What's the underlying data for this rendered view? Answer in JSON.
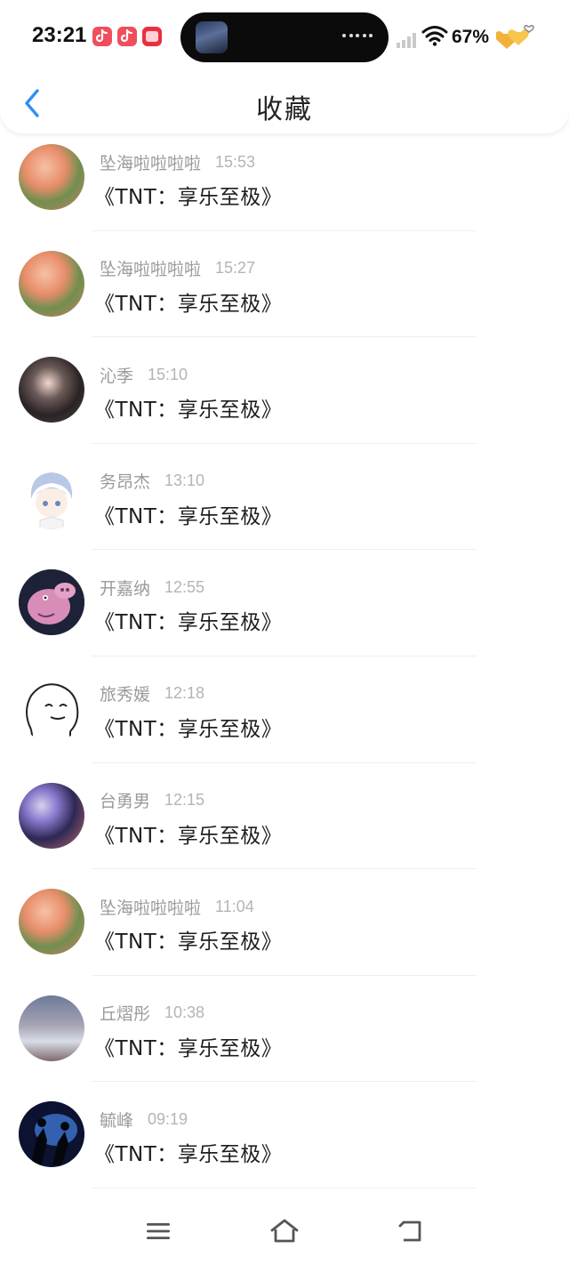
{
  "status_bar": {
    "time": "23:21",
    "battery": "67%",
    "notification_icons": [
      "douyin-icon",
      "douyin-icon",
      "app-icon"
    ]
  },
  "nav": {
    "title": "收藏",
    "back_icon": "chevron-left-icon",
    "accent_color": "#2f8ff5"
  },
  "messages": [
    {
      "name": "坠海啦啦啦啦",
      "time": "15:53",
      "text": "《TNT：享乐至极》"
    },
    {
      "name": "坠海啦啦啦啦",
      "time": "15:27",
      "text": "《TNT：享乐至极》"
    },
    {
      "name": "沁季",
      "time": "15:10",
      "text": "《TNT：享乐至极》"
    },
    {
      "name": "务昂杰",
      "time": "13:10",
      "text": "《TNT：享乐至极》"
    },
    {
      "name": "开嘉纳",
      "time": "12:55",
      "text": "《TNT：享乐至极》"
    },
    {
      "name": "旅秀媛",
      "time": "12:18",
      "text": "《TNT：享乐至极》"
    },
    {
      "name": "台勇男",
      "time": "12:15",
      "text": "《TNT：享乐至极》"
    },
    {
      "name": "坠海啦啦啦啦",
      "time": "11:04",
      "text": "《TNT：享乐至极》"
    },
    {
      "name": "丘熠彤",
      "time": "10:38",
      "text": "《TNT：享乐至极》"
    },
    {
      "name": "毓峰",
      "time": "09:19",
      "text": "《TNT：享乐至极》"
    }
  ],
  "bottom_nav": {
    "icons": [
      "menu-icon",
      "home-icon",
      "back-icon"
    ]
  }
}
